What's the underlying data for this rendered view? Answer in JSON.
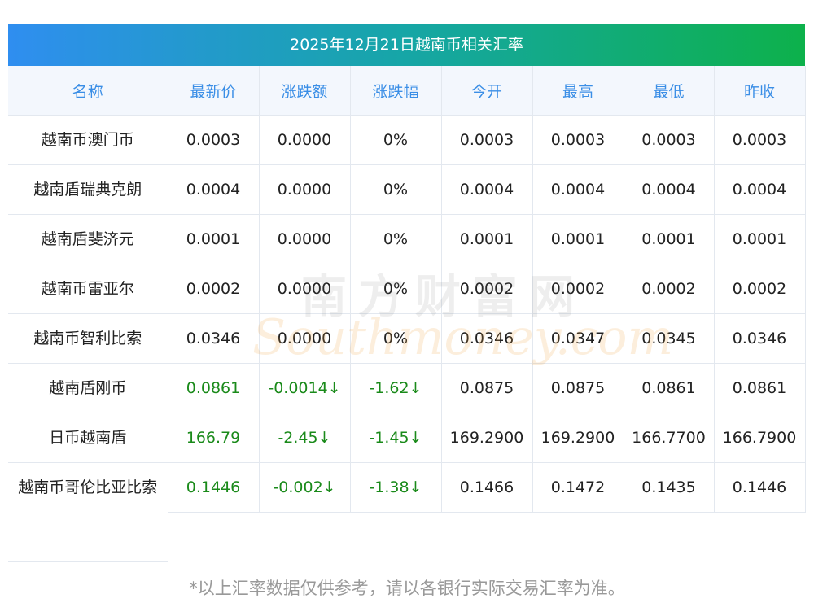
{
  "title": "2025年12月21日越南币相关汇率",
  "columns": [
    "名称",
    "最新价",
    "涨跌额",
    "涨跌幅",
    "今开",
    "最高",
    "最低",
    "昨收"
  ],
  "rows": [
    {
      "name": "越南币澳门币",
      "latest": "0.0003",
      "change": "0.0000",
      "change_pct": "0%",
      "open": "0.0003",
      "high": "0.0003",
      "low": "0.0003",
      "prev_close": "0.0003"
    },
    {
      "name": "越南盾瑞典克朗",
      "latest": "0.0004",
      "change": "0.0000",
      "change_pct": "0%",
      "open": "0.0004",
      "high": "0.0004",
      "low": "0.0004",
      "prev_close": "0.0004"
    },
    {
      "name": "越南盾斐济元",
      "latest": "0.0001",
      "change": "0.0000",
      "change_pct": "0%",
      "open": "0.0001",
      "high": "0.0001",
      "low": "0.0001",
      "prev_close": "0.0001"
    },
    {
      "name": "越南币雷亚尔",
      "latest": "0.0002",
      "change": "0.0000",
      "change_pct": "0%",
      "open": "0.0002",
      "high": "0.0002",
      "low": "0.0002",
      "prev_close": "0.0002"
    },
    {
      "name": "越南币智利比索",
      "latest": "0.0346",
      "change": "0.0000",
      "change_pct": "0%",
      "open": "0.0346",
      "high": "0.0347",
      "low": "0.0345",
      "prev_close": "0.0346"
    },
    {
      "name": "越南盾刚币",
      "latest": "0.0861",
      "change": "-0.0014↓",
      "change_pct": "-1.62↓",
      "open": "0.0875",
      "high": "0.0875",
      "low": "0.0861",
      "prev_close": "0.0861"
    },
    {
      "name": "日币越南盾",
      "latest": "166.79",
      "change": "-2.45↓",
      "change_pct": "-1.45↓",
      "open": "169.2900",
      "high": "169.2900",
      "low": "166.7700",
      "prev_close": "166.7900"
    },
    {
      "name": "越南币哥伦比亚比索",
      "latest": "0.1446",
      "change": "-0.002↓",
      "change_pct": "-1.38↓",
      "open": "0.1466",
      "high": "0.1472",
      "low": "0.1435",
      "prev_close": "0.1446"
    }
  ],
  "note": "*以上汇率数据仅供参考，请以各银行实际交易汇率为准。",
  "watermark": {
    "cn": "南方财富网",
    "en": "Southmoney.com"
  },
  "colors": {
    "header_text": "#3a8ee6",
    "down": "#1a8a1a",
    "title_gradient_start": "#2f8ef0",
    "title_gradient_end": "#0db14b"
  }
}
